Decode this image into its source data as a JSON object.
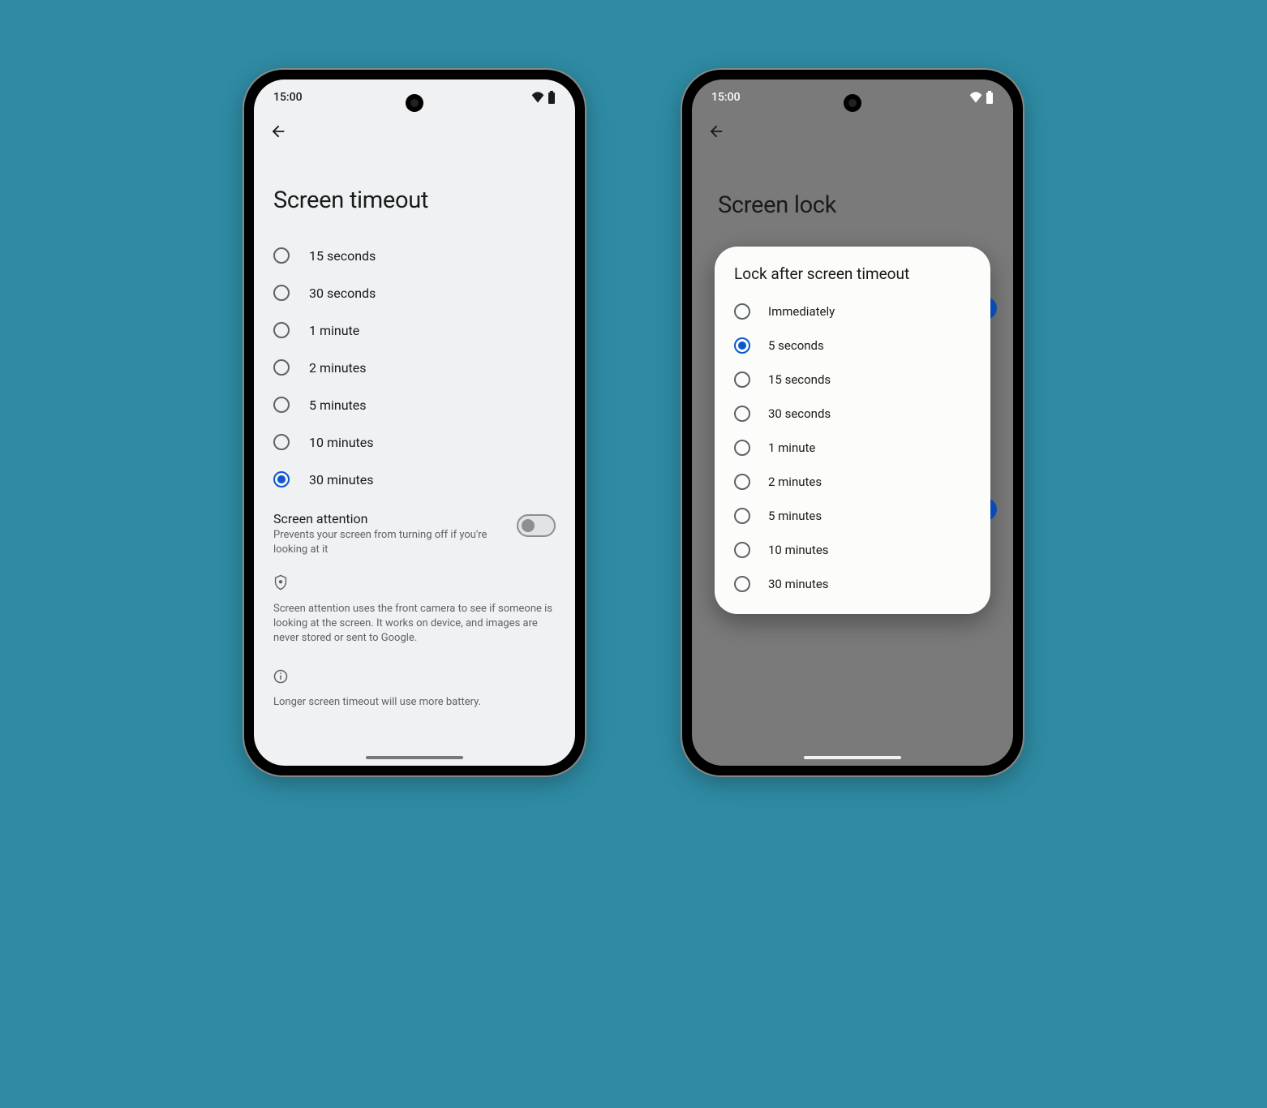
{
  "status": {
    "time": "15:00"
  },
  "left": {
    "title": "Screen timeout",
    "options": [
      {
        "label": "15 seconds",
        "selected": false
      },
      {
        "label": "30 seconds",
        "selected": false
      },
      {
        "label": "1 minute",
        "selected": false
      },
      {
        "label": "2 minutes",
        "selected": false
      },
      {
        "label": "5 minutes",
        "selected": false
      },
      {
        "label": "10 minutes",
        "selected": false
      },
      {
        "label": "30 minutes",
        "selected": true
      }
    ],
    "attention": {
      "title": "Screen attention",
      "sub": "Prevents your screen from turning off if you're looking at it",
      "enabled": false
    },
    "privacy_note": "Screen attention uses the front camera to see if someone is looking at the screen. It works on device, and images are never stored or sent to Google.",
    "battery_note": "Longer screen timeout will use more battery."
  },
  "right": {
    "title": "Screen lock",
    "dialog_title": "Lock after screen timeout",
    "options": [
      {
        "label": "Immediately",
        "selected": false
      },
      {
        "label": "5 seconds",
        "selected": true
      },
      {
        "label": "15 seconds",
        "selected": false
      },
      {
        "label": "30 seconds",
        "selected": false
      },
      {
        "label": "1 minute",
        "selected": false
      },
      {
        "label": "2 minutes",
        "selected": false
      },
      {
        "label": "5 minutes",
        "selected": false
      },
      {
        "label": "10 minutes",
        "selected": false
      },
      {
        "label": "30 minutes",
        "selected": false
      }
    ]
  }
}
